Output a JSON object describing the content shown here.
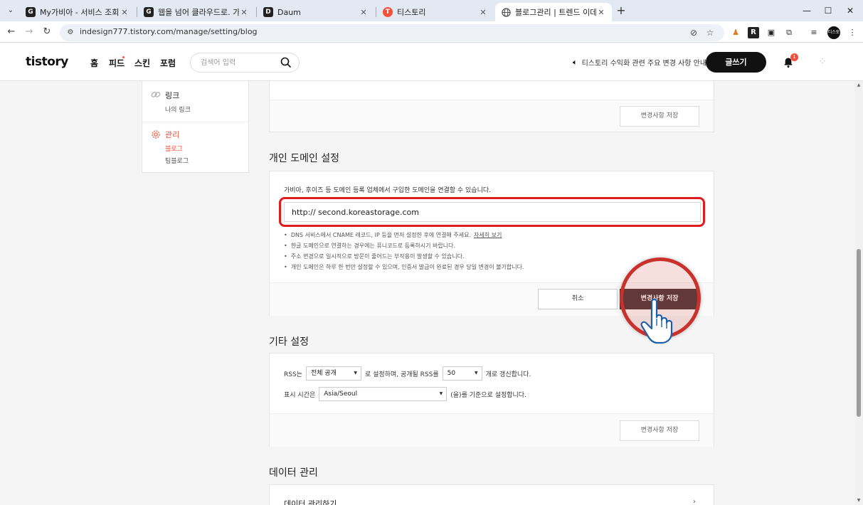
{
  "browser": {
    "tabs": [
      {
        "title": "My가비아 - 서비스 조회, 비용",
        "favicon": "G",
        "active": false
      },
      {
        "title": "웹을 넘어 클라우드로. 가비아",
        "favicon": "G",
        "active": false
      },
      {
        "title": "Daum",
        "favicon": "D",
        "active": false
      },
      {
        "title": "티스토리",
        "favicon": "T",
        "active": false
      },
      {
        "title": "블로그관리 | 트렌드 이데아",
        "favicon": "globe",
        "active": true
      }
    ],
    "tab_close_glyph": "✕",
    "new_tab_glyph": "+",
    "url": "indesign777.tistory.com/manage/setting/blog",
    "profile_label": "티스토리"
  },
  "header": {
    "logo": "tistory",
    "nav": [
      {
        "label": "홈"
      },
      {
        "label": "피드"
      },
      {
        "label": "스킨"
      },
      {
        "label": "포럼"
      }
    ],
    "search_placeholder": "검색어 입력",
    "notice": "티스토리 수익화 관련 주요 변경 사항 안내",
    "write_button": "글쓰기",
    "notification_count": "1"
  },
  "sidebar": {
    "link_title": "링크",
    "link_sub": "나의 링크",
    "manage_title": "관리",
    "manage_items": [
      "블로그",
      "팀블로그"
    ]
  },
  "top_card": {
    "save_button": "변경사항 저장"
  },
  "domain_section": {
    "title": "개인 도메인 설정",
    "description": "가비아, 후이즈 등 도메인 등록 업체에서 구입한 도메인을 연결할 수 있습니다.",
    "prefix": "http://",
    "domain_value": "second.koreastorage.com",
    "notes": [
      "DNS 서비스에서 CNAME 레코드, IP 등을 먼저 설정한 후에 연결해 주세요.",
      "한글 도메인으로 연결하는 경우에는 퓨니코드로 등록하시기 바랍니다.",
      "주소 변경으로 일시적으로 방문이 줄어드는 부작용이 발생할 수 있습니다.",
      "개인 도메인은 하루 한 번만 설정할 수 있으며, 인증서 발급이 완료된 경우 당일 변경이 불가합니다."
    ],
    "detail_link": "자세히 보기",
    "cancel_button": "취소",
    "save_button": "변경사항 저장"
  },
  "other_section": {
    "title": "기타 설정",
    "rss_prefix": "RSS는",
    "rss_scope": "전체 공개",
    "rss_middle": "로 설정하며, 공개될 RSS를",
    "rss_count": "50",
    "rss_suffix": "개로 갱신합니다.",
    "time_prefix": "표시 시간은",
    "timezone": "Asia/Seoul",
    "time_suffix": "(을)를 기준으로 설정합니다.",
    "save_button": "변경사항 저장"
  },
  "data_section": {
    "title": "데이터 관리",
    "row_label": "데이터 관리하기"
  },
  "colors": {
    "accent": "#f5503a",
    "highlight_red": "#e21c1c",
    "save_dark": "#4a3535"
  }
}
